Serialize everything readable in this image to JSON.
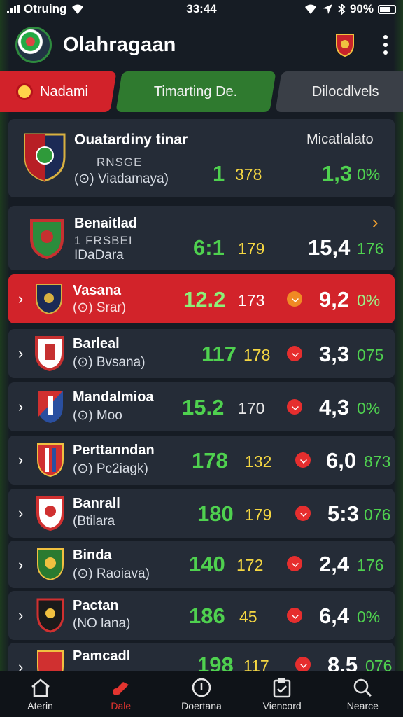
{
  "status_bar": {
    "carrier": "Otruing",
    "time": "33:44",
    "battery": "90%"
  },
  "header": {
    "title": "Olahragaan"
  },
  "tabs": [
    {
      "label": "Nadami"
    },
    {
      "label": "Timarting De."
    },
    {
      "label": "Dilocdlvels"
    }
  ],
  "featured": {
    "name": "Ouatardiny tinar",
    "line1": "RNSGE",
    "line2": "(⊙) Viadamaya)",
    "label": "Micatlalato",
    "val1": "1",
    "val2": "378",
    "val3": "1,3",
    "pct": "0%"
  },
  "rows": [
    {
      "name": "Benaitlad",
      "line1": "1 FRSBEI",
      "line2": "IDaDara",
      "val1": "6:1",
      "val2": "179",
      "val3": "15,4",
      "pct": "176"
    },
    {
      "name": "Vasana",
      "line2": "(⊙) Srar)",
      "val1": "12.2",
      "val2": "173",
      "val3": "9,2",
      "pct": "0%"
    },
    {
      "name": "Barleal",
      "line2": "(⊙) Bvsana)",
      "val1": "117",
      "val2": "178",
      "val3": "3,3",
      "pct": "075"
    },
    {
      "name": "Mandalmioa",
      "line2": "(⊙) Moo",
      "val1": "15.2",
      "val2": "170",
      "val3": "4,3",
      "pct": "0%"
    },
    {
      "name": "Perttanndan",
      "line2": "(⊙) Pc2iagk)",
      "val1": "178",
      "val2": "132",
      "val3": "6,0",
      "pct": "873"
    },
    {
      "name": "Banrall",
      "line2": "(Btilara",
      "val1": "180",
      "val2": "179",
      "val3": "5:3",
      "pct": "076"
    },
    {
      "name": "Binda",
      "line2": "(⊙) Raoiava)",
      "val1": "140",
      "val2": "172",
      "val3": "2,4",
      "pct": "176"
    },
    {
      "name": "Pactan",
      "line2": "(NO lana)",
      "val1": "186",
      "val2": "45",
      "val3": "6,4",
      "pct": "0%"
    },
    {
      "name": "Pamcadl",
      "line2": "",
      "val1": "198",
      "val2": "117",
      "val3": "8,5",
      "pct": "076"
    }
  ],
  "bottom_nav": [
    {
      "label": "Aterin",
      "icon": "home-icon"
    },
    {
      "label": "Dale",
      "icon": "whistle-icon"
    },
    {
      "label": "Doertana",
      "icon": "ball-icon"
    },
    {
      "label": "Viencord",
      "icon": "clipboard-icon"
    },
    {
      "label": "Nearce",
      "icon": "search-icon"
    }
  ],
  "colors": {
    "accent_red": "#d2232a",
    "accent_green": "#2f7a2f",
    "value_green": "#4fd14f",
    "value_yellow": "#f5d742"
  }
}
